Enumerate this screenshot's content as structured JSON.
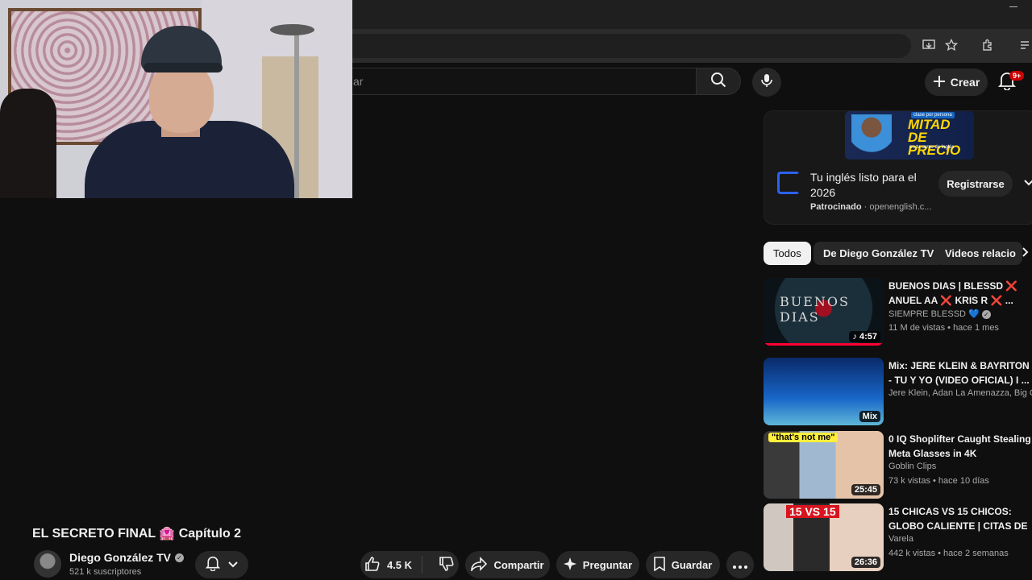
{
  "header": {
    "search_placeholder": "ar",
    "create_label": "Crear",
    "notifications_badge": "9+"
  },
  "video": {
    "title": "EL SECRETO FINAL 🏩 Capítulo 2",
    "channel": "Diego González TV",
    "subscribers": "521 k suscriptores",
    "likes": "4.5 K",
    "share_label": "Compartir",
    "ask_label": "Preguntar",
    "save_label": "Guardar"
  },
  "ad": {
    "banner_small": "clase por persona",
    "banner_big": "MITAD DE PRECIO",
    "banner_sub": "en tu curso de inglés",
    "title": "Tu inglés listo para el 2026",
    "sponsored": "Patrocinado",
    "domain": "openenglish.c...",
    "button": "Registrarse"
  },
  "chips": [
    "Todos",
    "De Diego González TV",
    "Videos relacio"
  ],
  "recommended": [
    {
      "title": "BUENOS DIAS | BLESSD ❌ ANUEL AA ❌ KRIS R ❌ ...",
      "channel": "SIEMPRE BLESSD 💙",
      "meta": "11 M de vistas • hace 1 mes",
      "duration": "♪ 4:57",
      "thumb_text": "BUENOS DIAS"
    },
    {
      "title": "Mix: JERE KLEIN & BAYRITON - TU Y YO (VIDEO OFICIAL) I ...",
      "channel": "Jere Klein, Adan La Amenazza, Big Cvrl",
      "meta": "",
      "duration": "Mix"
    },
    {
      "title": "0 IQ Shoplifter Caught Stealing Meta Glasses in 4K",
      "channel": "Goblin Clips",
      "meta": "73 k vistas • hace 10 días",
      "duration": "25:45",
      "thumb_text": "\"that's not me\""
    },
    {
      "title": "15 CHICAS VS 15 CHICOS: GLOBO CALIENTE | CITAS DE ...",
      "channel": "Varela",
      "meta": "442 k vistas • hace 2 semanas",
      "duration": "26:36",
      "thumb_text": "15 VS 15"
    }
  ]
}
